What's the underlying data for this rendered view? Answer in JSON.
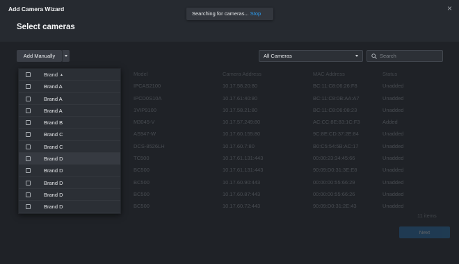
{
  "window": {
    "title": "Add Camera Wizard",
    "close_glyph": "×"
  },
  "page_title": "Select cameras",
  "toast": {
    "text": "Searching for cameras... ",
    "action": "Stop"
  },
  "toolbar": {
    "add_label": "Add Manually",
    "filter": {
      "value": "All Cameras"
    },
    "search": {
      "placeholder": "Search"
    }
  },
  "table": {
    "headers": [
      "Model",
      "Camera Address",
      "MAC Address",
      "Status"
    ],
    "rows": [
      [
        "IPCAS2100",
        "10.17.58.20:80",
        "BC:11:C8:06:26:F8",
        "Unadded"
      ],
      [
        "IPCD0S10A",
        "10.17.61:40:80",
        "BC:11:C8:0B:AA:A7",
        "Unadded"
      ],
      [
        "1VIP9100",
        "10.17.58.21:80",
        "BC:11:C8:06:08:23",
        "Unadded"
      ],
      [
        "M3045-V",
        "10.17.57.249:80",
        "AC:CC:8E:83:1C:F3",
        "Added"
      ],
      [
        "AS947-W",
        "10.17.60.155:80",
        "9C:8E:CD:37:2E:84",
        "Unadded"
      ],
      [
        "DCS-8526LH",
        "10.17.60.7:80",
        "B0:C5:54:5B:AC:17",
        "Unadded"
      ],
      [
        "TC500",
        "10.17.61.131:443",
        "00:00:23:34:45:66",
        "Unadded"
      ],
      [
        "BC500",
        "10.17.61.131:443",
        "90:09:D0:31:3E:E8",
        "Unadded"
      ],
      [
        "BC500",
        "10.17.60.90:443",
        "00:00:00:55:66:29",
        "Unadded"
      ],
      [
        "BC500",
        "10.17.60.87:443",
        "00:00:00:55:66:26",
        "Unadded"
      ],
      [
        "BC500",
        "10.17.60.72:443",
        "90:09:D0:31:2E:43",
        "Unadded"
      ]
    ],
    "total": "11 items",
    "next_label": "Next"
  },
  "dropdown": {
    "header": "Brand",
    "items": [
      "Brand A",
      "Brand A",
      "Brand A",
      "Brand B",
      "Brand C",
      "Brand C",
      "Brand D",
      "Brand D",
      "Brand D",
      "Brand D",
      "Brand D"
    ]
  },
  "colors": {
    "accent": "#2c9cf0",
    "header_bg": "#262a30",
    "body_bg": "#1f2227",
    "next_button": "#1f6fae"
  }
}
